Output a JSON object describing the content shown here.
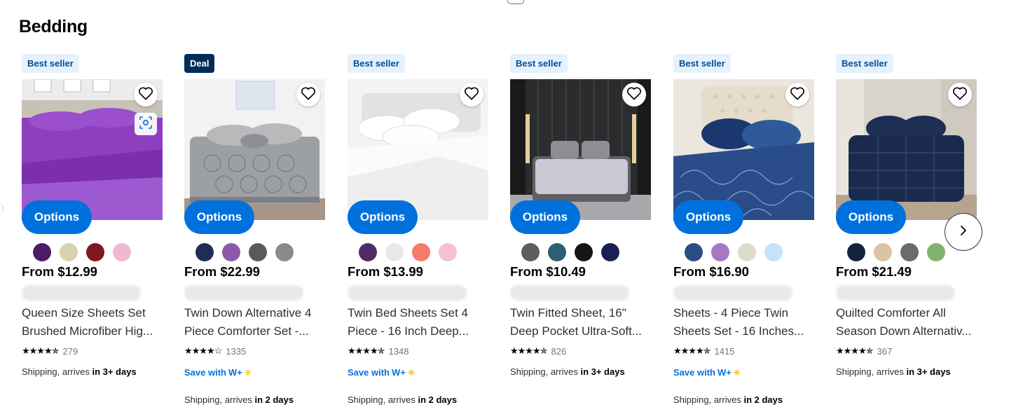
{
  "section": {
    "title": "Bedding"
  },
  "icons": {
    "heart": "heart-outline-icon",
    "scan": "visual-search-icon",
    "next": "chevron-right-icon",
    "star": "star-icon"
  },
  "colors": {
    "primary": "#0071dc",
    "best_badge_bg": "#e6f1fc",
    "best_badge_text": "#004f9a",
    "deal_badge_bg": "#002d58",
    "spark": "#ffc220"
  },
  "cards": [
    {
      "badge": "Best seller",
      "badge_type": "best",
      "options_label": "Options",
      "swatches": [
        "#4b1c66",
        "#d9d3b3",
        "#7d1820",
        "#f2b8d2"
      ],
      "price": "From $12.99",
      "title_line1": "Queen Size Sheets Set",
      "title_line2": "Brushed Microfiber Hig...",
      "stars": "★★★★✯",
      "rating": 4.5,
      "review_count": "279",
      "shipping": "Shipping, arrives ",
      "shipping_bold": "in 3+ days"
    },
    {
      "badge": "Deal",
      "badge_type": "deal",
      "options_label": "Options",
      "swatches": [
        "#1d2e55",
        "#8e5aa8",
        "#5a5a5e",
        "#888b8e"
      ],
      "price": "From $22.99",
      "title_line1": "Twin Down Alternative 4",
      "title_line2": "Piece Comforter Set -...",
      "stars": "★★★★☆",
      "rating": 4.0,
      "review_count": "1335",
      "save_label": "Save with",
      "save_brand": "W+",
      "shipping2": "Shipping, arrives ",
      "shipping2_bold": "in 2 days"
    },
    {
      "badge": "Best seller",
      "badge_type": "best",
      "options_label": "Options",
      "swatches": [
        "#4f2c66",
        "#e8e8e8",
        "#f77b6a",
        "#f5bfd8"
      ],
      "price": "From $13.99",
      "title_line1": "Twin Bed Sheets Set 4",
      "title_line2": "Piece - 16 Inch Deep...",
      "stars": "★★★★✯",
      "rating": 4.5,
      "review_count": "1348",
      "save_label": "Save with",
      "save_brand": "W+",
      "shipping2": "Shipping, arrives ",
      "shipping2_bold": "in 2 days"
    },
    {
      "badge": "Best seller",
      "badge_type": "best",
      "options_label": "Options",
      "swatches": [
        "#5e5e60",
        "#2c5f70",
        "#151515",
        "#1a1f56"
      ],
      "price": "From $10.49",
      "title_line1": "Twin Fitted Sheet, 16\"",
      "title_line2": "Deep Pocket Ultra-Soft...",
      "stars": "★★★★✯",
      "rating": 4.5,
      "review_count": "826",
      "shipping": "Shipping, arrives ",
      "shipping_bold": "in 3+ days"
    },
    {
      "badge": "Best seller",
      "badge_type": "best",
      "options_label": "Options",
      "swatches": [
        "#2a4e85",
        "#a878c2",
        "#dddccb",
        "#c7e2f6"
      ],
      "price": "From $16.90",
      "title_line1": "Sheets - 4 Piece Twin",
      "title_line2": "Sheets Set - 16 Inches...",
      "stars": "★★★★✯",
      "rating": 4.5,
      "review_count": "1415",
      "save_label": "Save with",
      "save_brand": "W+",
      "shipping2": "Shipping, arrives ",
      "shipping2_bold": "in 2 days"
    },
    {
      "badge": "Best seller",
      "badge_type": "best",
      "options_label": "Options",
      "swatches": [
        "#14233e",
        "#dcc3a6",
        "#6b6b6e",
        "#7fb370"
      ],
      "price": "From $21.49",
      "title_line1": "Quilted Comforter All",
      "title_line2": "Season Down Alternativ...",
      "stars": "★★★★✯",
      "rating": 4.5,
      "review_count": "367",
      "shipping": "Shipping, arrives ",
      "shipping_bold": "in 3+ days"
    }
  ]
}
